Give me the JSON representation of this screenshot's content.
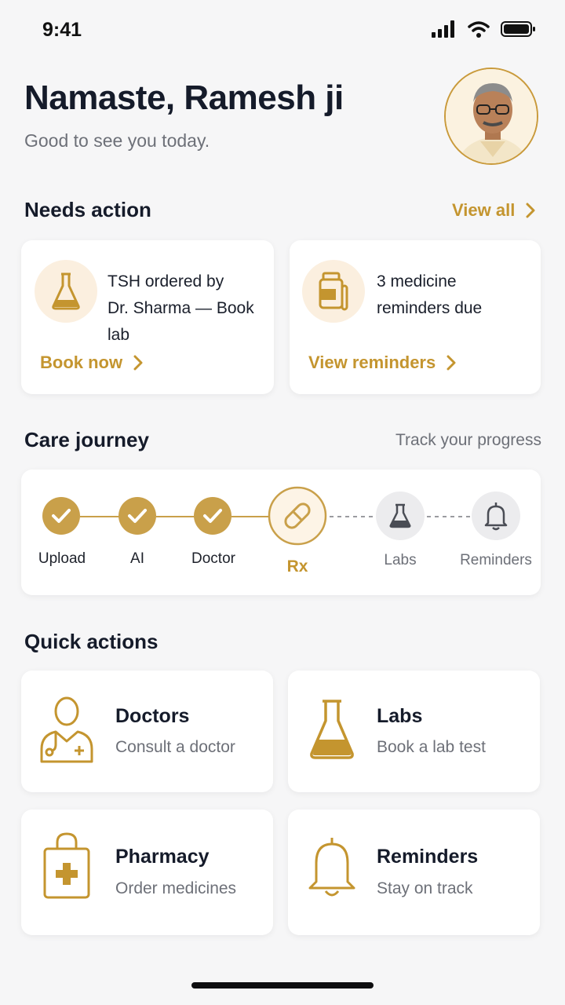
{
  "status_bar": {
    "time": "9:41"
  },
  "greeting": {
    "title": "Namaste, Ramesh ji",
    "subtitle": "Good to see you today."
  },
  "needs_action": {
    "title": "Needs action",
    "view_all": "View all",
    "cards": [
      {
        "line1": "TSH ordered by",
        "line2": "Dr. Sharma — Book lab",
        "link": "Book now",
        "icon": "flask-icon"
      },
      {
        "line1": "3 medicine",
        "line2": "reminders due",
        "link": "View reminders",
        "icon": "medicine-bottle-icon"
      }
    ]
  },
  "care_journey": {
    "title": "Care journey",
    "subtitle": "Track your progress",
    "steps": [
      {
        "label": "Upload",
        "state": "done"
      },
      {
        "label": "AI",
        "state": "done"
      },
      {
        "label": "Doctor",
        "state": "done"
      },
      {
        "label": "Rx",
        "state": "current"
      },
      {
        "label": "Labs",
        "state": "pending"
      },
      {
        "label": "Reminders",
        "state": "pending"
      }
    ]
  },
  "quick_actions": {
    "title": "Quick actions",
    "items": [
      {
        "title": "Doctors",
        "subtitle": "Consult a doctor",
        "icon": "doctor-icon"
      },
      {
        "title": "Labs",
        "subtitle": "Book a lab test",
        "icon": "flask-icon"
      },
      {
        "title": "Pharmacy",
        "subtitle": "Order medicines",
        "icon": "pharmacy-bag-icon"
      },
      {
        "title": "Reminders",
        "subtitle": "Stay on track",
        "icon": "bell-icon"
      }
    ]
  },
  "colors": {
    "accent": "#c4952f",
    "accent_soft": "#fbefdf",
    "background": "#f6f6f7",
    "text": "#151b2a"
  }
}
